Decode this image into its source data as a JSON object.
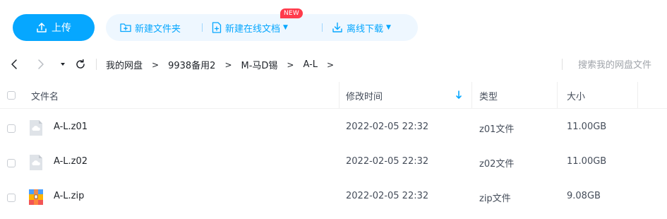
{
  "toolbar": {
    "upload_label": "上传",
    "new_folder_label": "新建文件夹",
    "new_online_doc_label": "新建在线文档",
    "new_badge": "NEW",
    "offline_download_label": "离线下载",
    "accent_color": "#06a7ff",
    "bar_color": "#eef7ff"
  },
  "nav": {
    "breadcrumbs": [
      "我的网盘",
      "9938备用2",
      "M-马D锡",
      "A-L"
    ],
    "separator": ">",
    "search_placeholder": "搜索我的网盘文件"
  },
  "table": {
    "headers": {
      "name": "文件名",
      "modified": "修改时间",
      "type": "类型",
      "size": "大小"
    },
    "sort_indicator": "↓",
    "rows": [
      {
        "name": "A-L.z01",
        "modified": "2022-02-05 22:32",
        "type": "z01文件",
        "size": "11.00GB",
        "icon": "cloud-file-icon"
      },
      {
        "name": "A-L.z02",
        "modified": "2022-02-05 22:32",
        "type": "z02文件",
        "size": "11.00GB",
        "icon": "cloud-file-icon"
      },
      {
        "name": "A-L.zip",
        "modified": "2022-02-05 22:32",
        "type": "zip文件",
        "size": "9.08GB",
        "icon": "zip-archive-icon"
      }
    ]
  }
}
